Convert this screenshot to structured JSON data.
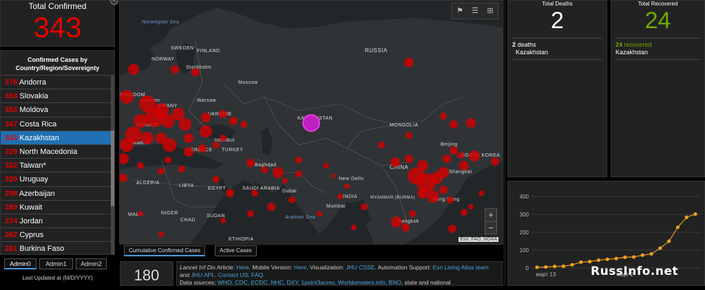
{
  "total_confirmed": {
    "label": "Total Confirmed",
    "value": "343"
  },
  "list": {
    "header": "Confirmed Cases by Country/Region/Sovereignty",
    "rows": [
      {
        "n": "376",
        "name": "Andorra"
      },
      {
        "n": "363",
        "name": "Slovakia"
      },
      {
        "n": "353",
        "name": "Moldova"
      },
      {
        "n": "347",
        "name": "Costa Rica"
      },
      {
        "n": "343",
        "name": "Kazakhstan"
      },
      {
        "n": "329",
        "name": "North Macedonia"
      },
      {
        "n": "322",
        "name": "Taiwan*"
      },
      {
        "n": "320",
        "name": "Uruguay"
      },
      {
        "n": "298",
        "name": "Azerbaijan"
      },
      {
        "n": "289",
        "name": "Kuwait"
      },
      {
        "n": "274",
        "name": "Jordan"
      },
      {
        "n": "262",
        "name": "Cyprus"
      },
      {
        "n": "261",
        "name": "Burkina Faso"
      }
    ],
    "selected_index": 4
  },
  "left_tabs": [
    "Admin0",
    "Admin1",
    "Admin2"
  ],
  "updated_label": "Last Updated at (M/D/YYYY)",
  "map": {
    "labels": {
      "norwegian_sea": "Norwegian Sea",
      "sweden": "SWEDEN",
      "finland": "FINLAND",
      "norway": "NORWAY",
      "russia": "RUSSIA",
      "stockholm": "Stockholm",
      "moscow": "Moscow",
      "kingdom": "KINGDOM",
      "warsaw": "Warsaw",
      "london": "London",
      "germany": "RMANY",
      "ukraine": "UKRAINE",
      "france": "FRANCE",
      "kazakhstan": "KAZAKHSTAN",
      "mongolia": "MONGOLIA",
      "madrid": "Madrid",
      "istanbul": "Istanbul",
      "greece": "GREECE",
      "turkey": "TURKEY",
      "beijing": "Beijing",
      "south_korea": "SOUTH KOREA",
      "china": "CHINA",
      "baghdad": "Baghdad",
      "algeria": "ALGERIA",
      "libya": "LIBYA",
      "egypt": "EGYPT",
      "saudi_arabia": "SAUDI ARABIA",
      "dubai": "Dubai",
      "new_delhi": "New Delhi",
      "shanghai": "Shanghai",
      "india": "INDIA",
      "myanmar": "MYANMAR (BURMA)",
      "mumbai": "Mumbai",
      "hong_kong": "Hong Kong",
      "mali": "MALI",
      "niger": "NIGER",
      "chad": "CHAD",
      "sudan": "SUDAN",
      "arabian_sea": "Arabian Sea",
      "bangkok": "Bangkok",
      "ethiopia": "ETHIOPIA"
    },
    "attribution": "Esri, FAO, NOAA",
    "buttons": [
      "bookmark-icon",
      "list-icon",
      "grid-icon"
    ],
    "zoom_in": "+",
    "zoom_out": "−"
  },
  "map_tabs": [
    "Cumulative Confirmed Cases",
    "Active Cases"
  ],
  "count_box": "180",
  "info": {
    "p1_italic": "Lancet Inf Dis",
    "p1_a": " Article: ",
    "here1": "Here",
    "p1_b": ". Mobile Version: ",
    "here2": "Here",
    "p1_c": ". Visualization: ",
    "jhu_csse": "JHU CSSE",
    "p1_d": ". Automation Support: ",
    "esri_living": "Esri Living Atlas team",
    "p1_e": " and ",
    "jhu_apl": "JHU APL",
    "p1_f": ". ",
    "contact": "Contact US",
    "p1_g": ". ",
    "faq": "FAQ",
    "p1_h": ".",
    "p2_a": "Data sources: ",
    "sources": "WHO, CDC, ECDC, NHC, DXY, 1point3acres, Worldometers.info, BNO,",
    "p2_b": " state and national"
  },
  "deaths": {
    "label": "Total Deaths",
    "value": "2",
    "detail_num": "2",
    "detail_unit": "deaths",
    "detail_place": "Kazakhstan"
  },
  "recovered": {
    "label": "Total Recovered",
    "value": "24",
    "detail_num": "24",
    "detail_unit": "recovered",
    "detail_place": "Kazakhstan"
  },
  "chart_data": {
    "type": "line",
    "x": [
      "март 13",
      "",
      "",
      "",
      "",
      "",
      "",
      "",
      "",
      "",
      "",
      "",
      "",
      "",
      "",
      "",
      "",
      "",
      "март 31"
    ],
    "y_ticks": [
      "400",
      "300",
      "200",
      "100",
      "0"
    ],
    "x_tick_labels": [
      "март 13",
      "март 2"
    ],
    "ylim": [
      0,
      400
    ],
    "values": [
      4,
      6,
      9,
      10,
      18,
      33,
      36,
      44,
      49,
      53,
      60,
      62,
      72,
      79,
      111,
      150,
      228,
      284,
      302
    ],
    "color": "#f0a020"
  },
  "watermark": "RussInfo.net",
  "colors": {
    "confirmed": "#e60000",
    "recovered": "#70a800",
    "link": "#4aa3df",
    "selected": "#1f6fb2"
  }
}
